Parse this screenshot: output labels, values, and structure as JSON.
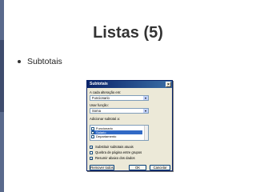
{
  "slide": {
    "title": "Listas (5)",
    "bullet": "Subtotais"
  },
  "dialog": {
    "title": "Subtotais",
    "close_glyph": "×",
    "group_label": "A cada alteração em:",
    "group_value": "Funcionario",
    "function_label": "Usar função:",
    "function_value": "Soma",
    "add_label": "Adicionar subtotal a:",
    "columns": [
      {
        "label": "Funcionario",
        "checked": false,
        "selected": false
      },
      {
        "label": "Salario",
        "checked": true,
        "selected": true
      },
      {
        "label": "Departamento",
        "checked": false,
        "selected": false
      }
    ],
    "options": [
      {
        "label": "Substituir subtotais atuais",
        "checked": true
      },
      {
        "label": "Quebra de página entre grupos",
        "checked": false
      },
      {
        "label": "Resumir abaixo dos dados",
        "checked": true
      }
    ],
    "buttons": {
      "remove_all": "Remover todos",
      "ok": "OK",
      "cancel": "Cancelar"
    }
  },
  "colors": {
    "accent_bar": "#5a6a8c",
    "title_bar": "#0a246a",
    "selection": "#316ac5"
  }
}
